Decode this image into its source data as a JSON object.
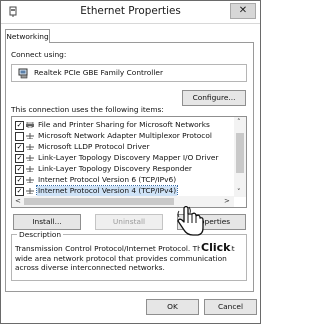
{
  "window": {
    "title": "Ethernet Properties",
    "close_glyph": "✕"
  },
  "tabs": [
    {
      "label": "Networking"
    }
  ],
  "connect": {
    "label": "Connect using:",
    "adapter": "Realtek PCIe GBE Family Controller"
  },
  "buttons": {
    "configure": "Configure...",
    "install": "Install...",
    "uninstall": "Uninstall",
    "properties": "Properties",
    "ok": "OK",
    "cancel": "Cancel"
  },
  "items_header": "This connection uses the following items:",
  "items": [
    {
      "label": "File and Printer Sharing for Microsoft Networks",
      "checked": true,
      "icon": "printer-share-icon"
    },
    {
      "label": "Microsoft Network Adapter Multiplexor Protocol",
      "checked": false,
      "icon": "protocol-icon"
    },
    {
      "label": "Microsoft LLDP Protocol Driver",
      "checked": true,
      "icon": "protocol-icon"
    },
    {
      "label": "Link-Layer Topology Discovery Mapper I/O Driver",
      "checked": true,
      "icon": "protocol-icon"
    },
    {
      "label": "Link-Layer Topology Discovery Responder",
      "checked": true,
      "icon": "protocol-icon"
    },
    {
      "label": "Internet Protocol Version 6 (TCP/IPv6)",
      "checked": true,
      "icon": "protocol-icon"
    },
    {
      "label": "Internet Protocol Version 4 (TCP/IPv4)",
      "checked": true,
      "icon": "protocol-icon",
      "selected": true
    }
  ],
  "description": {
    "legend": "Description",
    "text": "Transmission Control Protocol/Internet Protocol. The default wide area network protocol that provides communication across diverse interconnected networks."
  },
  "annotation": {
    "click_label": "Click"
  },
  "colors": {
    "selection": "#cfe3f7",
    "button_face": "#e6e6e6",
    "border": "#8f8f8f"
  }
}
